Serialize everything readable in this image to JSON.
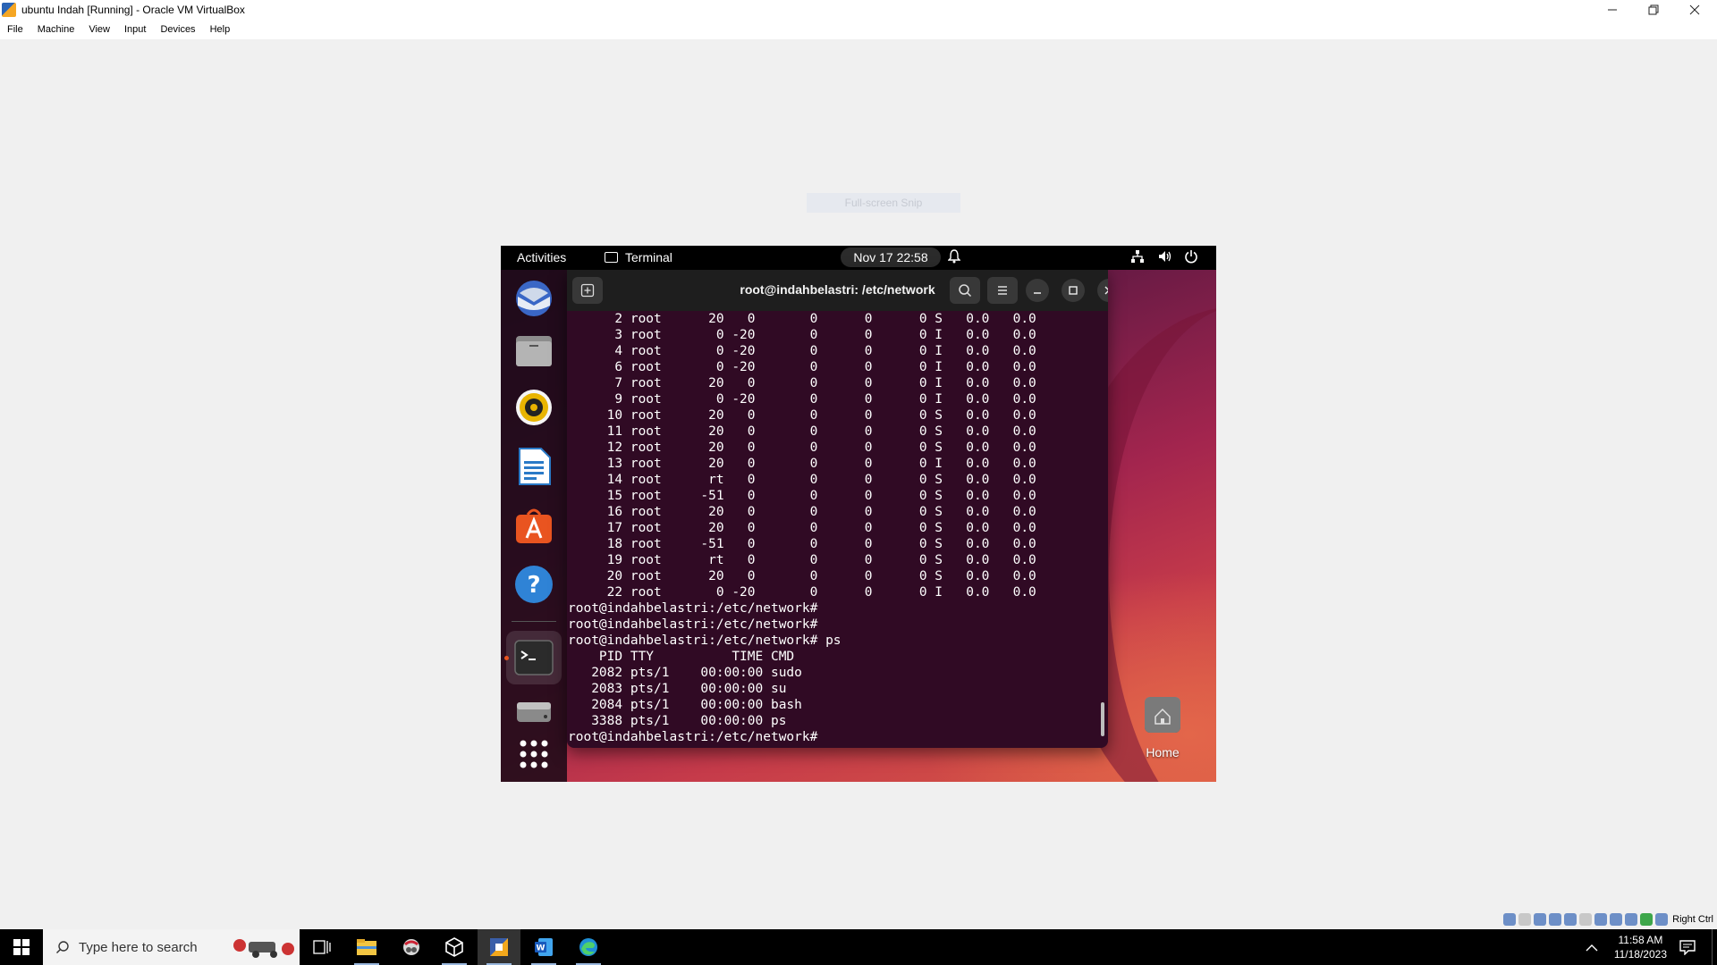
{
  "host": {
    "title": "ubuntu Indah [Running] - Oracle VM VirtualBox",
    "menu": [
      "File",
      "Machine",
      "View",
      "Input",
      "Devices",
      "Help"
    ],
    "snip_hint": "Full-screen Snip",
    "status_right": "Right Ctrl"
  },
  "guest": {
    "topbar": {
      "activities": "Activities",
      "app_name": "Terminal",
      "clock": "Nov 17  22:58"
    },
    "terminal": {
      "title": "root@indahbelastri: /etc/network",
      "lines": [
        "      2 root      20   0       0      0      0 S   0.0   0.0",
        "      3 root       0 -20       0      0      0 I   0.0   0.0",
        "      4 root       0 -20       0      0      0 I   0.0   0.0",
        "      6 root       0 -20       0      0      0 I   0.0   0.0",
        "      7 root      20   0       0      0      0 I   0.0   0.0",
        "      9 root       0 -20       0      0      0 I   0.0   0.0",
        "     10 root      20   0       0      0      0 S   0.0   0.0",
        "     11 root      20   0       0      0      0 S   0.0   0.0",
        "     12 root      20   0       0      0      0 S   0.0   0.0",
        "     13 root      20   0       0      0      0 I   0.0   0.0",
        "     14 root      rt   0       0      0      0 S   0.0   0.0",
        "     15 root     -51   0       0      0      0 S   0.0   0.0",
        "     16 root      20   0       0      0      0 S   0.0   0.0",
        "     17 root      20   0       0      0      0 S   0.0   0.0",
        "     18 root     -51   0       0      0      0 S   0.0   0.0",
        "     19 root      rt   0       0      0      0 S   0.0   0.0",
        "     20 root      20   0       0      0      0 S   0.0   0.0",
        "     22 root       0 -20       0      0      0 I   0.0   0.0",
        "root@indahbelastri:/etc/network#",
        "root@indahbelastri:/etc/network#",
        "root@indahbelastri:/etc/network# ps",
        "    PID TTY          TIME CMD",
        "   2082 pts/1    00:00:00 sudo",
        "   2083 pts/1    00:00:00 su",
        "   2084 pts/1    00:00:00 bash",
        "   3388 pts/1    00:00:00 ps",
        "root@indahbelastri:/etc/network#"
      ]
    },
    "desktop": {
      "home_label": "Home"
    }
  },
  "taskbar": {
    "search_placeholder": "Type here to search",
    "time": "11:58 AM",
    "date": "11/18/2023"
  },
  "colors": {
    "terminal_bg": "#300a24",
    "ubuntu_orange": "#e95420",
    "header_bg": "#1e1e1e"
  }
}
